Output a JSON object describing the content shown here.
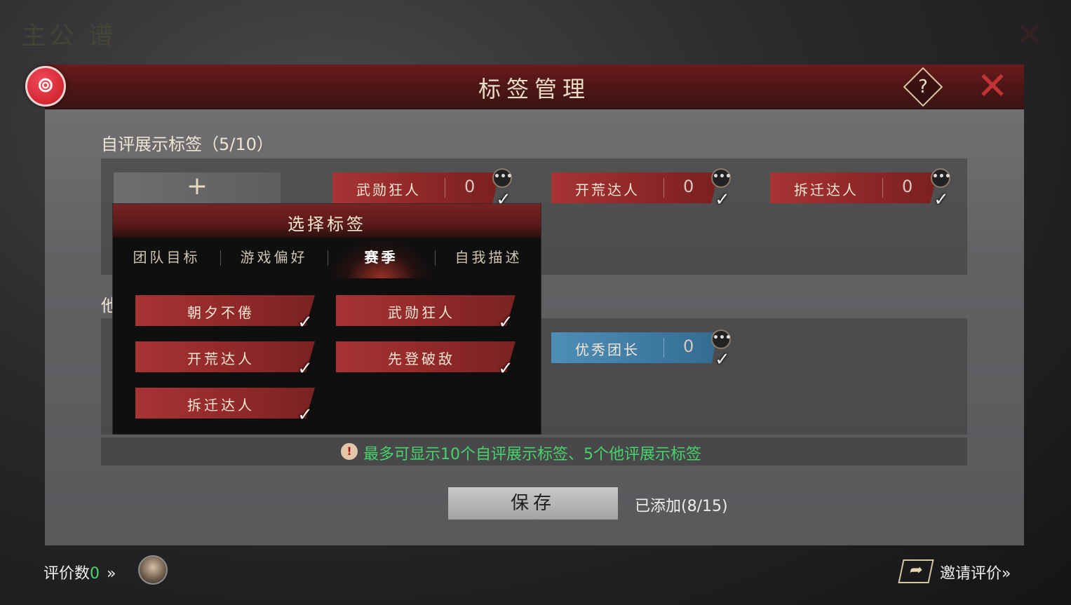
{
  "background": {
    "title": "主公 谱"
  },
  "header": {
    "title": "标签管理",
    "help_label": "?",
    "close_label": "✕",
    "logo_label": "⊚"
  },
  "self_section": {
    "label": "自评展示标签（5/10）",
    "add_label": "+"
  },
  "self_tags": [
    {
      "name": "武勋狂人",
      "count": "0"
    },
    {
      "name": "开荒达人",
      "count": "0"
    },
    {
      "name": "拆迁达人",
      "count": "0"
    }
  ],
  "other_section": {
    "label": "他评"
  },
  "other_tags": [
    {
      "name": "优秀团长",
      "count": "0"
    }
  ],
  "popup": {
    "title": "选择标签",
    "tabs": [
      "团队目标",
      "游戏偏好",
      "赛季",
      "自我描述"
    ],
    "active_tab": "赛季",
    "tags": [
      "朝夕不倦",
      "武勋狂人",
      "开荒达人",
      "先登破敌",
      "拆迁达人"
    ]
  },
  "notice": {
    "icon": "!",
    "text": "最多可显示10个自评展示标签、5个他评展示标签"
  },
  "save": {
    "label": "保存"
  },
  "added": {
    "text": "已添加(8/15)"
  },
  "footer": {
    "reviews_label": "评价数",
    "reviews_count": "0",
    "reviews_chevron": "»",
    "invite_label": "邀请评价",
    "invite_chevron": "»"
  },
  "icons": {
    "more": "•••",
    "check": "✓",
    "share": "➦"
  },
  "colors": {
    "accent_red": "#a83434",
    "accent_blue": "#4e8fb6",
    "notice_green": "#47d36b"
  }
}
